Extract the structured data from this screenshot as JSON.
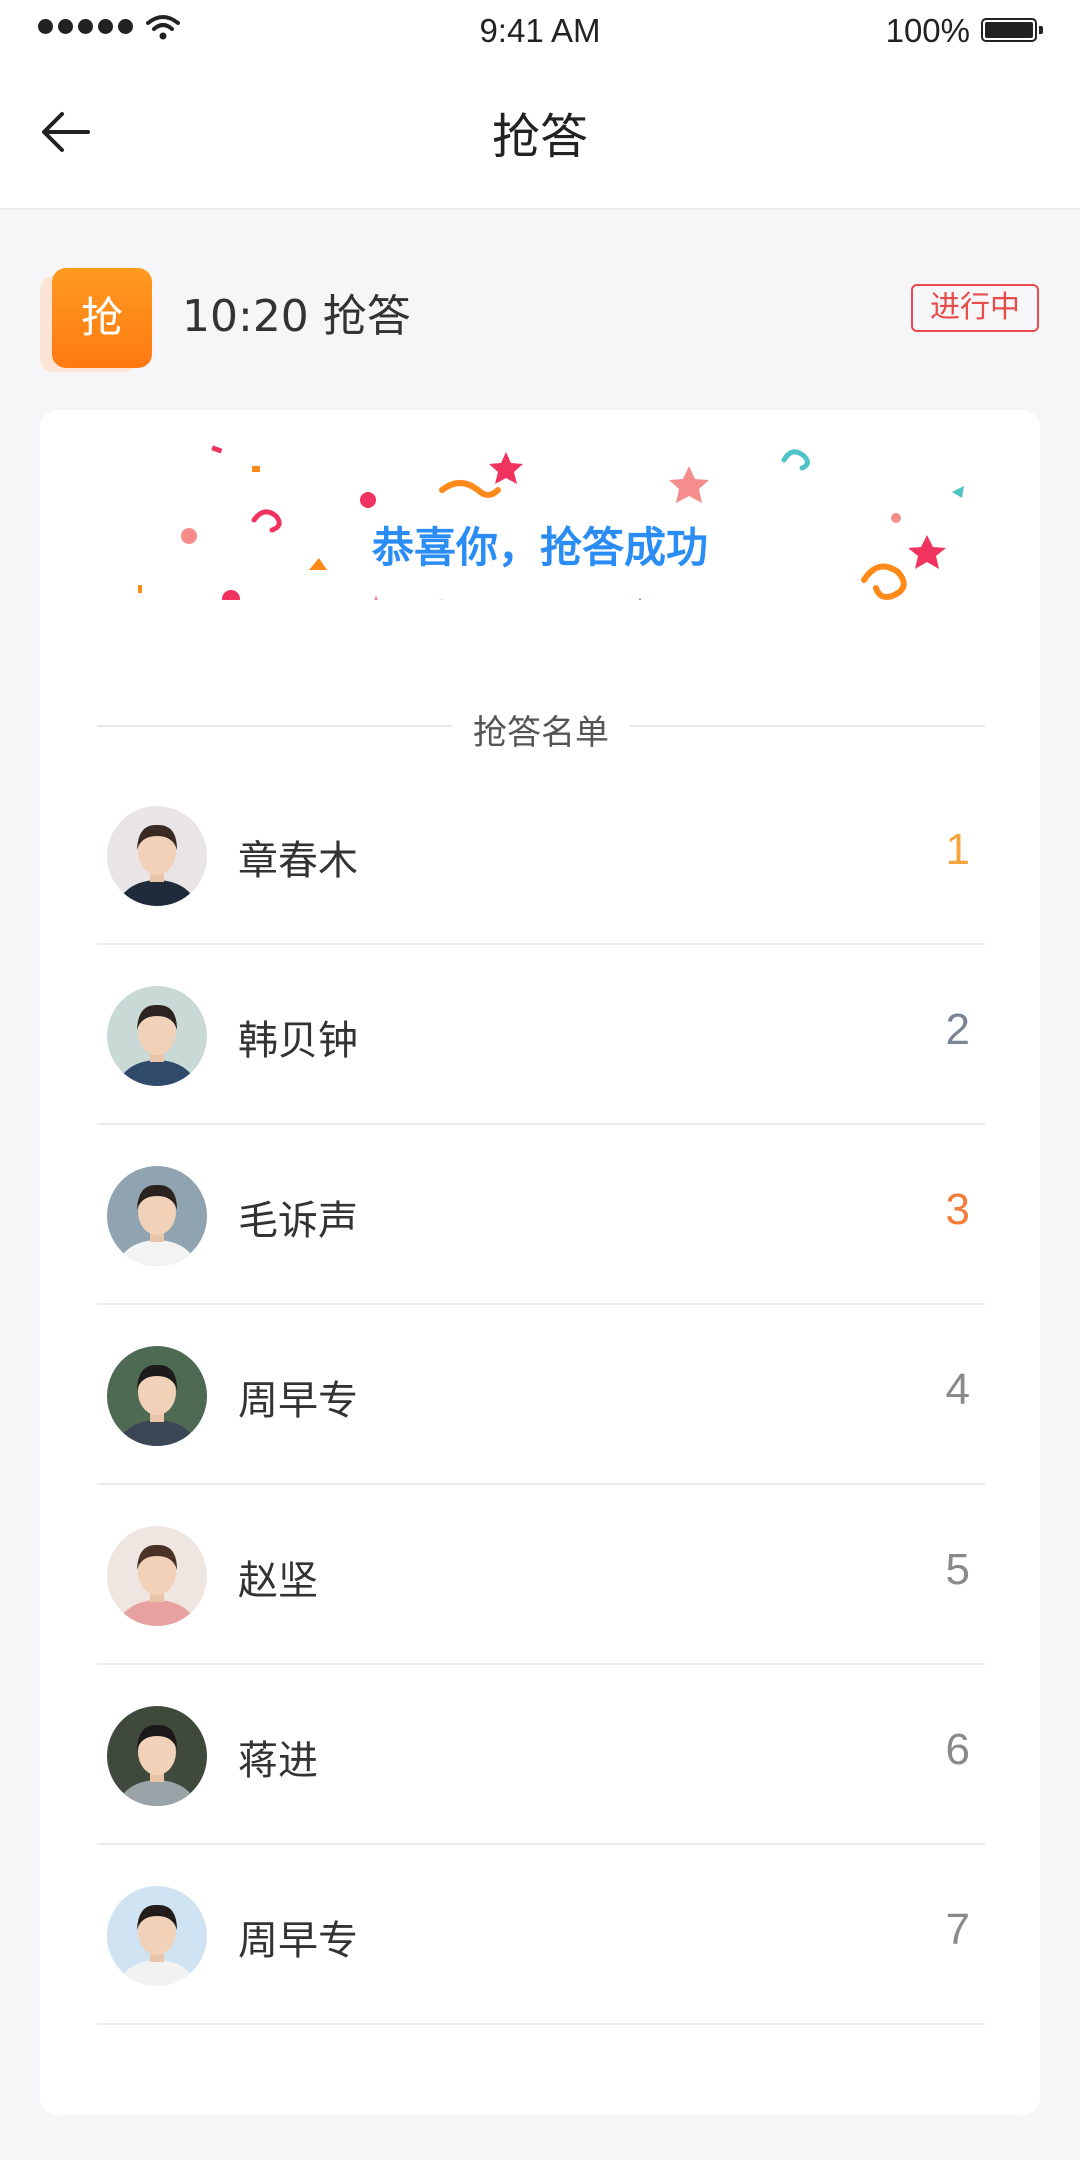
{
  "status_bar": {
    "time": "9:41 AM",
    "battery": "100%"
  },
  "nav": {
    "title": "抢答"
  },
  "session": {
    "icon_char": "抢",
    "title": "10:20  抢答",
    "status": "进行中"
  },
  "card": {
    "success_message": "恭喜你，抢答成功",
    "list_title": "抢答名单"
  },
  "colors": {
    "accent_blue": "#2a8cf5",
    "rank_gold": "#f5a53b",
    "rank_silver": "#7a8495",
    "rank_bronze": "#f27d3a",
    "rank_default": "#8a8a8a",
    "status_red": "#e84b4b",
    "brand_orange": "#ff8a1a"
  },
  "participants": [
    {
      "name": "章春木",
      "rank": "1",
      "rank_color": "#f5a53b",
      "avatar_bg": "#e9e4e6",
      "avatar_hair": "#3a2a24",
      "avatar_shirt": "#1f2a3a"
    },
    {
      "name": "韩贝钟",
      "rank": "2",
      "rank_color": "#7a8495",
      "avatar_bg": "#c9d9d6",
      "avatar_hair": "#2b2320",
      "avatar_shirt": "#2f4a6a"
    },
    {
      "name": "毛诉声",
      "rank": "3",
      "rank_color": "#f27d3a",
      "avatar_bg": "#8fa4b0",
      "avatar_hair": "#2a221e",
      "avatar_shirt": "#f3f3f3"
    },
    {
      "name": "周早专",
      "rank": "4",
      "rank_color": "#8a8a8a",
      "avatar_bg": "#4f6a52",
      "avatar_hair": "#1c1a1a",
      "avatar_shirt": "#3a4656"
    },
    {
      "name": "赵坚",
      "rank": "5",
      "rank_color": "#8a8a8a",
      "avatar_bg": "#efe6e2",
      "avatar_hair": "#4a3226",
      "avatar_shirt": "#e7a1a1"
    },
    {
      "name": "蒋进",
      "rank": "6",
      "rank_color": "#8a8a8a",
      "avatar_bg": "#3f4a3c",
      "avatar_hair": "#1a1818",
      "avatar_shirt": "#9aa3a8"
    },
    {
      "name": "周早专",
      "rank": "7",
      "rank_color": "#8a8a8a",
      "avatar_bg": "#cfe3f2",
      "avatar_hair": "#221c1a",
      "avatar_shirt": "#f2f2f2"
    }
  ]
}
